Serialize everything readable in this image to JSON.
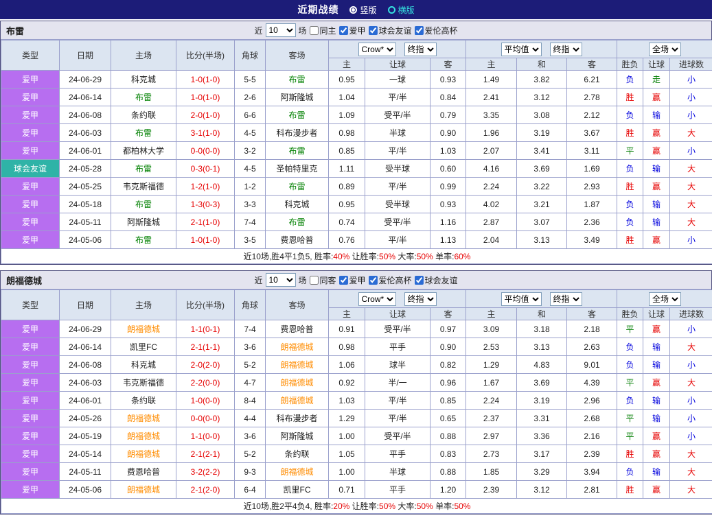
{
  "topbar": {
    "title": "近期战绩",
    "vertical": "竖版",
    "horizontal": "横版"
  },
  "colors": {
    "red": "#e60000",
    "green": "#007d00",
    "blue": "#0000dd",
    "purple": "#b76ef0",
    "teal": "#2fb3a7",
    "navy": "#1c1c78"
  },
  "columns": {
    "type": "类型",
    "date": "日期",
    "home": "主场",
    "score": "比分(半场)",
    "corner": "角球",
    "away": "客场",
    "h": "主",
    "handicap": "让球",
    "a": "客",
    "avg_h": "主",
    "avg_d": "和",
    "avg_a": "客",
    "result": "胜负",
    "asia": "让球",
    "goals": "进球数"
  },
  "controls": {
    "bookmaker": "Crow*",
    "final": "终指",
    "average": "平均值",
    "final2": "终指",
    "scope": "全场"
  },
  "sections": [
    {
      "team": "布雷",
      "team_color": "#008000",
      "filters": {
        "recent": "近",
        "count": "10",
        "games": "场",
        "checks": [
          {
            "label": "同主",
            "checked": false
          },
          {
            "label": "爱甲",
            "checked": true
          },
          {
            "label": "球会友谊",
            "checked": true
          },
          {
            "label": "爱伦高杯",
            "checked": true
          }
        ]
      },
      "rows": [
        {
          "league": "爱甲",
          "league_color": "purple",
          "date": "24-06-29",
          "home": "科克城",
          "home_hl": false,
          "score": "1-0(1-0)",
          "corner": "5-5",
          "away": "布雷",
          "away_hl": true,
          "odds1": "0.95",
          "handicap": "一球",
          "odds2": "0.93",
          "avg1": "1.49",
          "avg2": "3.82",
          "avg3": "6.21",
          "result": "负",
          "result_c": "blue",
          "asia": "走",
          "asia_c": "green",
          "goal": "小",
          "goal_c": "blue"
        },
        {
          "league": "爱甲",
          "league_color": "purple",
          "date": "24-06-14",
          "home": "布雷",
          "home_hl": true,
          "score": "1-0(1-0)",
          "corner": "2-6",
          "away": "阿斯隆城",
          "away_hl": false,
          "odds1": "1.04",
          "handicap": "平/半",
          "odds2": "0.84",
          "avg1": "2.41",
          "avg2": "3.12",
          "avg3": "2.78",
          "result": "胜",
          "result_c": "red",
          "asia": "赢",
          "asia_c": "red",
          "goal": "小",
          "goal_c": "blue"
        },
        {
          "league": "爱甲",
          "league_color": "purple",
          "date": "24-06-08",
          "home": "条约联",
          "home_hl": false,
          "score": "2-0(1-0)",
          "corner": "6-6",
          "away": "布雷",
          "away_hl": true,
          "odds1": "1.09",
          "handicap": "受平/半",
          "odds2": "0.79",
          "avg1": "3.35",
          "avg2": "3.08",
          "avg3": "2.12",
          "result": "负",
          "result_c": "blue",
          "asia": "输",
          "asia_c": "blue",
          "goal": "小",
          "goal_c": "blue"
        },
        {
          "league": "爱甲",
          "league_color": "purple",
          "date": "24-06-03",
          "home": "布雷",
          "home_hl": true,
          "score": "3-1(1-0)",
          "corner": "4-5",
          "away": "科布漫步者",
          "away_hl": false,
          "odds1": "0.98",
          "handicap": "半球",
          "odds2": "0.90",
          "avg1": "1.96",
          "avg2": "3.19",
          "avg3": "3.67",
          "result": "胜",
          "result_c": "red",
          "asia": "赢",
          "asia_c": "red",
          "goal": "大",
          "goal_c": "red"
        },
        {
          "league": "爱甲",
          "league_color": "purple",
          "date": "24-06-01",
          "home": "都柏林大学",
          "home_hl": false,
          "score": "0-0(0-0)",
          "corner": "3-2",
          "away": "布雷",
          "away_hl": true,
          "odds1": "0.85",
          "handicap": "平/半",
          "odds2": "1.03",
          "avg1": "2.07",
          "avg2": "3.41",
          "avg3": "3.11",
          "result": "平",
          "result_c": "green",
          "asia": "赢",
          "asia_c": "red",
          "goal": "小",
          "goal_c": "blue"
        },
        {
          "league": "球会友谊",
          "league_color": "teal",
          "date": "24-05-28",
          "home": "布雷",
          "home_hl": true,
          "score": "0-3(0-1)",
          "corner": "4-5",
          "away": "圣帕特里克",
          "away_hl": false,
          "odds1": "1.11",
          "handicap": "受半球",
          "odds2": "0.60",
          "avg1": "4.16",
          "avg2": "3.69",
          "avg3": "1.69",
          "result": "负",
          "result_c": "blue",
          "asia": "输",
          "asia_c": "blue",
          "goal": "大",
          "goal_c": "red"
        },
        {
          "league": "爱甲",
          "league_color": "purple",
          "date": "24-05-25",
          "home": "韦克斯福德",
          "home_hl": false,
          "score": "1-2(1-0)",
          "corner": "1-2",
          "away": "布雷",
          "away_hl": true,
          "odds1": "0.89",
          "handicap": "平/半",
          "odds2": "0.99",
          "avg1": "2.24",
          "avg2": "3.22",
          "avg3": "2.93",
          "result": "胜",
          "result_c": "red",
          "asia": "赢",
          "asia_c": "red",
          "goal": "大",
          "goal_c": "red"
        },
        {
          "league": "爱甲",
          "league_color": "purple",
          "date": "24-05-18",
          "home": "布雷",
          "home_hl": true,
          "score": "1-3(0-3)",
          "corner": "3-3",
          "away": "科克城",
          "away_hl": false,
          "odds1": "0.95",
          "handicap": "受半球",
          "odds2": "0.93",
          "avg1": "4.02",
          "avg2": "3.21",
          "avg3": "1.87",
          "result": "负",
          "result_c": "blue",
          "asia": "输",
          "asia_c": "blue",
          "goal": "大",
          "goal_c": "red"
        },
        {
          "league": "爱甲",
          "league_color": "purple",
          "date": "24-05-11",
          "home": "阿斯隆城",
          "home_hl": false,
          "score": "2-1(1-0)",
          "corner": "7-4",
          "away": "布雷",
          "away_hl": true,
          "odds1": "0.74",
          "handicap": "受平/半",
          "odds2": "1.16",
          "avg1": "2.87",
          "avg2": "3.07",
          "avg3": "2.36",
          "result": "负",
          "result_c": "blue",
          "asia": "输",
          "asia_c": "blue",
          "goal": "大",
          "goal_c": "red"
        },
        {
          "league": "爱甲",
          "league_color": "purple",
          "date": "24-05-06",
          "home": "布雷",
          "home_hl": true,
          "score": "1-0(1-0)",
          "corner": "3-5",
          "away": "费恩哈普",
          "away_hl": false,
          "odds1": "0.76",
          "handicap": "平/半",
          "odds2": "1.13",
          "avg1": "2.04",
          "avg2": "3.13",
          "avg3": "3.49",
          "result": "胜",
          "result_c": "red",
          "asia": "赢",
          "asia_c": "red",
          "goal": "小",
          "goal_c": "blue"
        }
      ],
      "summary": {
        "prefix": "近10场,胜4平1负5,",
        "l1": " 胜率:",
        "v1": "40%",
        "l2": " 让胜率:",
        "v2": "50%",
        "l3": " 大率:",
        "v3": "50%",
        "l4": " 单率:",
        "v4": "60%"
      }
    },
    {
      "team": "朗福德城",
      "team_color": "#ff8c00",
      "filters": {
        "recent": "近",
        "count": "10",
        "games": "场",
        "checks": [
          {
            "label": "同客",
            "checked": false
          },
          {
            "label": "爱甲",
            "checked": true
          },
          {
            "label": "爱伦高杯",
            "checked": true
          },
          {
            "label": "球会友谊",
            "checked": true
          }
        ]
      },
      "rows": [
        {
          "league": "爱甲",
          "league_color": "purple",
          "date": "24-06-29",
          "home": "朗福德城",
          "home_hl": true,
          "score": "1-1(0-1)",
          "corner": "7-4",
          "away": "费恩哈普",
          "away_hl": false,
          "odds1": "0.91",
          "handicap": "受平/半",
          "odds2": "0.97",
          "avg1": "3.09",
          "avg2": "3.18",
          "avg3": "2.18",
          "result": "平",
          "result_c": "green",
          "asia": "赢",
          "asia_c": "red",
          "goal": "小",
          "goal_c": "blue"
        },
        {
          "league": "爱甲",
          "league_color": "purple",
          "date": "24-06-14",
          "home": "凯里FC",
          "home_hl": false,
          "score": "2-1(1-1)",
          "corner": "3-6",
          "away": "朗福德城",
          "away_hl": true,
          "odds1": "0.98",
          "handicap": "平手",
          "odds2": "0.90",
          "avg1": "2.53",
          "avg2": "3.13",
          "avg3": "2.63",
          "result": "负",
          "result_c": "blue",
          "asia": "输",
          "asia_c": "blue",
          "goal": "大",
          "goal_c": "red"
        },
        {
          "league": "爱甲",
          "league_color": "purple",
          "date": "24-06-08",
          "home": "科克城",
          "home_hl": false,
          "score": "2-0(2-0)",
          "corner": "5-2",
          "away": "朗福德城",
          "away_hl": true,
          "odds1": "1.06",
          "handicap": "球半",
          "odds2": "0.82",
          "avg1": "1.29",
          "avg2": "4.83",
          "avg3": "9.01",
          "result": "负",
          "result_c": "blue",
          "asia": "输",
          "asia_c": "blue",
          "goal": "小",
          "goal_c": "blue"
        },
        {
          "league": "爱甲",
          "league_color": "purple",
          "date": "24-06-03",
          "home": "韦克斯福德",
          "home_hl": false,
          "score": "2-2(0-0)",
          "corner": "4-7",
          "away": "朗福德城",
          "away_hl": true,
          "odds1": "0.92",
          "handicap": "半/一",
          "odds2": "0.96",
          "avg1": "1.67",
          "avg2": "3.69",
          "avg3": "4.39",
          "result": "平",
          "result_c": "green",
          "asia": "赢",
          "asia_c": "red",
          "goal": "大",
          "goal_c": "red"
        },
        {
          "league": "爱甲",
          "league_color": "purple",
          "date": "24-06-01",
          "home": "条约联",
          "home_hl": false,
          "score": "1-0(0-0)",
          "corner": "8-4",
          "away": "朗福德城",
          "away_hl": true,
          "odds1": "1.03",
          "handicap": "平/半",
          "odds2": "0.85",
          "avg1": "2.24",
          "avg2": "3.19",
          "avg3": "2.96",
          "result": "负",
          "result_c": "blue",
          "asia": "输",
          "asia_c": "blue",
          "goal": "小",
          "goal_c": "blue"
        },
        {
          "league": "爱甲",
          "league_color": "purple",
          "date": "24-05-26",
          "home": "朗福德城",
          "home_hl": true,
          "score": "0-0(0-0)",
          "corner": "4-4",
          "away": "科布漫步者",
          "away_hl": false,
          "odds1": "1.29",
          "handicap": "平/半",
          "odds2": "0.65",
          "avg1": "2.37",
          "avg2": "3.31",
          "avg3": "2.68",
          "result": "平",
          "result_c": "green",
          "asia": "输",
          "asia_c": "blue",
          "goal": "小",
          "goal_c": "blue"
        },
        {
          "league": "爱甲",
          "league_color": "purple",
          "date": "24-05-19",
          "home": "朗福德城",
          "home_hl": true,
          "score": "1-1(0-0)",
          "corner": "3-6",
          "away": "阿斯隆城",
          "away_hl": false,
          "odds1": "1.00",
          "handicap": "受平/半",
          "odds2": "0.88",
          "avg1": "2.97",
          "avg2": "3.36",
          "avg3": "2.16",
          "result": "平",
          "result_c": "green",
          "asia": "赢",
          "asia_c": "red",
          "goal": "小",
          "goal_c": "blue"
        },
        {
          "league": "爱甲",
          "league_color": "purple",
          "date": "24-05-14",
          "home": "朗福德城",
          "home_hl": true,
          "score": "2-1(2-1)",
          "corner": "5-2",
          "away": "条约联",
          "away_hl": false,
          "odds1": "1.05",
          "handicap": "平手",
          "odds2": "0.83",
          "avg1": "2.73",
          "avg2": "3.17",
          "avg3": "2.39",
          "result": "胜",
          "result_c": "red",
          "asia": "赢",
          "asia_c": "red",
          "goal": "大",
          "goal_c": "red"
        },
        {
          "league": "爱甲",
          "league_color": "purple",
          "date": "24-05-11",
          "home": "费恩哈普",
          "home_hl": false,
          "score": "3-2(2-2)",
          "corner": "9-3",
          "away": "朗福德城",
          "away_hl": true,
          "odds1": "1.00",
          "handicap": "半球",
          "odds2": "0.88",
          "avg1": "1.85",
          "avg2": "3.29",
          "avg3": "3.94",
          "result": "负",
          "result_c": "blue",
          "asia": "输",
          "asia_c": "blue",
          "goal": "大",
          "goal_c": "red"
        },
        {
          "league": "爱甲",
          "league_color": "purple",
          "date": "24-05-06",
          "home": "朗福德城",
          "home_hl": true,
          "score": "2-1(2-0)",
          "corner": "6-4",
          "away": "凯里FC",
          "away_hl": false,
          "odds1": "0.71",
          "handicap": "平手",
          "odds2": "1.20",
          "avg1": "2.39",
          "avg2": "3.12",
          "avg3": "2.81",
          "result": "胜",
          "result_c": "red",
          "asia": "赢",
          "asia_c": "red",
          "goal": "大",
          "goal_c": "red"
        }
      ],
      "summary": {
        "prefix": "近10场,胜2平4负4,",
        "l1": " 胜率:",
        "v1": "20%",
        "l2": " 让胜率:",
        "v2": "50%",
        "l3": " 大率:",
        "v3": "50%",
        "l4": " 单率:",
        "v4": "50%"
      }
    }
  ]
}
